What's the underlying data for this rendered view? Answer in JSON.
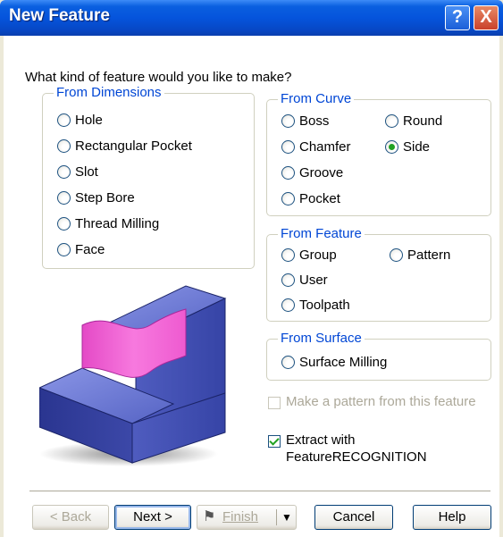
{
  "window": {
    "title": "New Feature",
    "help_glyph": "?",
    "close_glyph": "X"
  },
  "question": "What kind of feature would you like to make?",
  "groups": {
    "from_dimensions": {
      "legend": "From Dimensions",
      "options": [
        "Hole",
        "Rectangular Pocket",
        "Slot",
        "Step Bore",
        "Thread Milling",
        "Face"
      ]
    },
    "from_curve": {
      "legend": "From Curve",
      "options": [
        "Boss",
        "Round",
        "Chamfer",
        "Side",
        "Groove",
        "Pocket"
      ],
      "selected": "Side"
    },
    "from_feature": {
      "legend": "From Feature",
      "options": [
        "Group",
        "Pattern",
        "User",
        "Toolpath"
      ]
    },
    "from_surface": {
      "legend": "From Surface",
      "options": [
        "Surface Milling"
      ]
    }
  },
  "checkboxes": {
    "pattern": {
      "label": "Make a pattern from this feature",
      "checked": false,
      "enabled": false
    },
    "extract": {
      "label": "Extract with FeatureRECOGNITION",
      "checked": true,
      "enabled": true
    }
  },
  "buttons": {
    "back": "< Back",
    "next": "Next >",
    "finish": "Finish",
    "cancel": "Cancel",
    "help": "Help"
  },
  "colors": {
    "titlebar": "#0554dc",
    "group_legend": "#0046d5",
    "block_blue": "#4a57b8",
    "surface_pink": "#f06ad8",
    "radio_dot": "#21a121"
  },
  "icons": {
    "illustration": "feature-block-icon",
    "finish": "checkered-flag-icon",
    "finish_menu": "chevron-down-icon"
  }
}
